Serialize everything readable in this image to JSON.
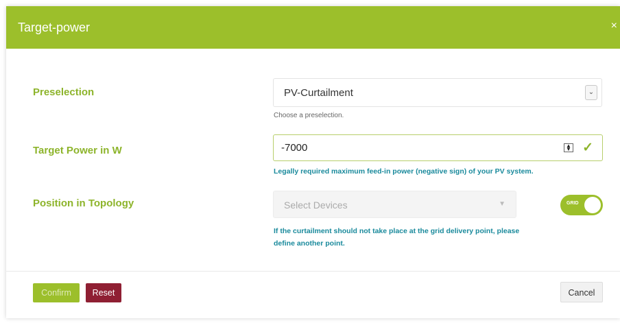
{
  "dialog": {
    "title": "Target-power",
    "close_label": "×"
  },
  "preselection": {
    "label": "Preselection",
    "value": "PV-Curtailment",
    "hint": "Choose a preselection."
  },
  "target_power": {
    "label": "Target Power in W",
    "value": "-7000",
    "hint": "Legally required maximum feed-in power (negative sign) of your PV system."
  },
  "topology": {
    "label": "Position in Topology",
    "placeholder": "Select Devices",
    "toggle_label": "GRID",
    "toggle_on": true,
    "hint_line1": "If the curtailment should not take place at the grid delivery point, please",
    "hint_line2": "define another point."
  },
  "footer": {
    "confirm_label": "Confirm",
    "reset_label": "Reset",
    "cancel_label": "Cancel"
  },
  "colors": {
    "header": "#9cbf2b",
    "label": "#8db42b",
    "note": "#1a8a9c",
    "reset": "#8f1f33"
  },
  "icons": {
    "close": "close-icon",
    "dropdown": "chevron-down-icon",
    "stepper": "number-stepper-icon",
    "valid": "checkmark-icon"
  }
}
